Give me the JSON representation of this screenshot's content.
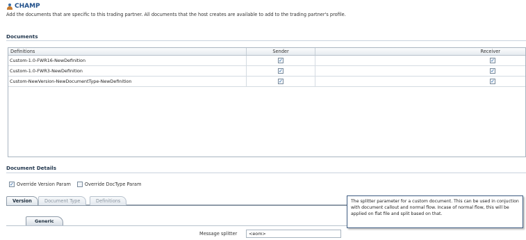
{
  "header": {
    "title": "CHAMP",
    "icon": "user-icon",
    "subtitle": "Add the documents that are specific to this trading partner. All documents that the host creates are available to add to the trading partner's profile."
  },
  "documents": {
    "section_title": "Documents",
    "columns": [
      "Definitions",
      "Sender",
      "Receiver"
    ],
    "rows": [
      {
        "definition": "Custom-1.0-FWR16-NewDefinition",
        "sender": true,
        "receiver": true
      },
      {
        "definition": "Custom-1.0-FWR3-NewDefinition",
        "sender": true,
        "receiver": true
      },
      {
        "definition": "Custom-NewVersion-NewDocumentType-NewDefinition",
        "sender": true,
        "receiver": true
      }
    ]
  },
  "details": {
    "section_title": "Document Details",
    "override_version_label": "Override Version Param",
    "override_version_checked": true,
    "override_doctype_label": "Override DocType Param",
    "override_doctype_checked": false
  },
  "tabs": [
    "Version",
    "Document Type",
    "Definitions"
  ],
  "active_tab": "Version",
  "subtabs": [
    "Generic"
  ],
  "field": {
    "label": "Message splitter",
    "value": "<eom>"
  },
  "tooltip": {
    "text": "The splitter parameter for a custom document. This can be used in conjuction with document callout and normal flow. Incase of normal flow, this will be applied on flat file and split based on that."
  },
  "colors": {
    "accent": "#1f4f8a",
    "check": "#1f5fa3",
    "border": "#a8b4c0"
  }
}
